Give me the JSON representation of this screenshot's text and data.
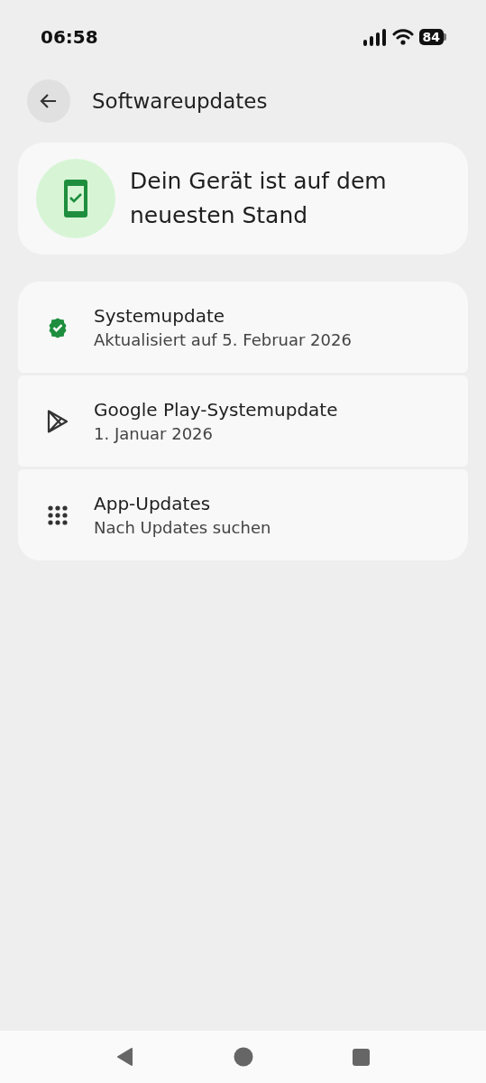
{
  "status_bar": {
    "time": "06:58",
    "battery": "84"
  },
  "header": {
    "title": "Softwareupdates"
  },
  "status_card": {
    "message": "Dein Gerät ist auf dem neuesten Stand"
  },
  "items": [
    {
      "kind": "check",
      "title": "Systemupdate",
      "subtitle": "Aktualisiert auf 5. Februar 2026"
    },
    {
      "kind": "play",
      "title": "Google Play-Systemupdate",
      "subtitle": "1. Januar 2026"
    },
    {
      "kind": "grid",
      "title": "App-Updates",
      "subtitle": "Nach Updates suchen"
    }
  ]
}
